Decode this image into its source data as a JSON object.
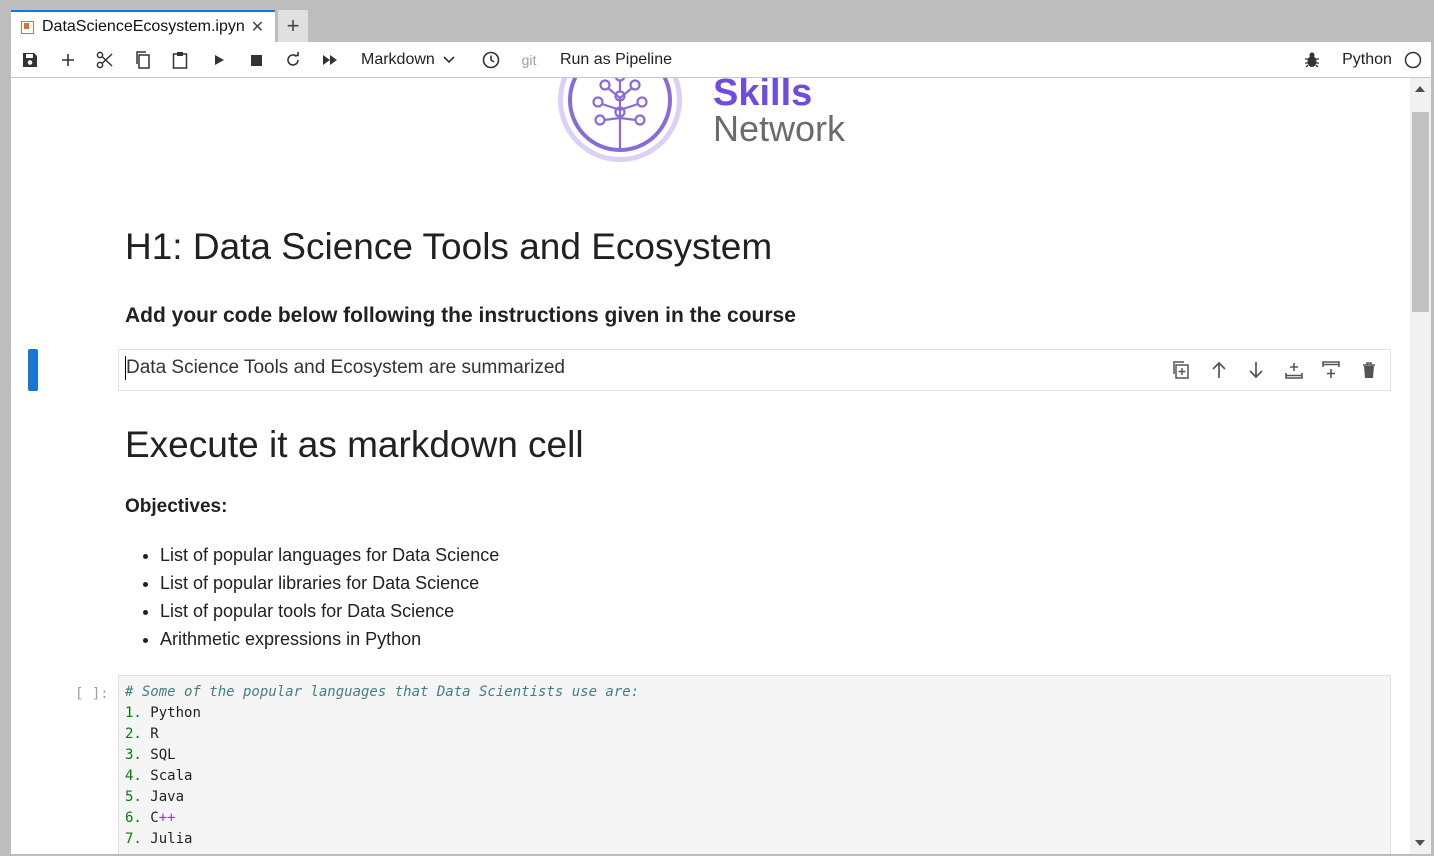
{
  "tab": {
    "title": "DataScienceEcosystem.ipyn",
    "close": "✕",
    "new_tab": "+"
  },
  "toolbar": {
    "cell_type": "Markdown",
    "git": "git",
    "run_pipeline": "Run as Pipeline",
    "kernel": "Python"
  },
  "logo": {
    "line1": "Skills",
    "line2": "Network"
  },
  "headings": {
    "h1": "H1: Data Science Tools and Ecosystem",
    "h3": "Add your code below following the instructions given in the course"
  },
  "edit_cell": {
    "text": "Data Science Tools and Ecosystem are summarized"
  },
  "section": {
    "title": "Execute it as markdown cell",
    "objectives_label": "Objectives:",
    "objectives": [
      "List of popular languages for Data Science",
      "List of popular libraries for Data Science",
      "List of popular tools for Data Science",
      "Arithmetic expressions in Python"
    ]
  },
  "code_cell": {
    "prompt": "[ ]:",
    "comment": "# Some of the popular languages that Data Scientists use are:",
    "items": [
      {
        "num": "1.",
        "text": "Python",
        "op": ""
      },
      {
        "num": "2.",
        "text": "R",
        "op": ""
      },
      {
        "num": "3.",
        "text": "SQL",
        "op": ""
      },
      {
        "num": "4.",
        "text": "Scala",
        "op": ""
      },
      {
        "num": "5.",
        "text": "Java",
        "op": ""
      },
      {
        "num": "6.",
        "text": "C",
        "op": "++"
      },
      {
        "num": "7.",
        "text": "Julia",
        "op": ""
      }
    ]
  },
  "colors": {
    "accent": "#1976d2",
    "logo_purple": "#6f4ce0",
    "tab_icon": "#e46e2e"
  }
}
